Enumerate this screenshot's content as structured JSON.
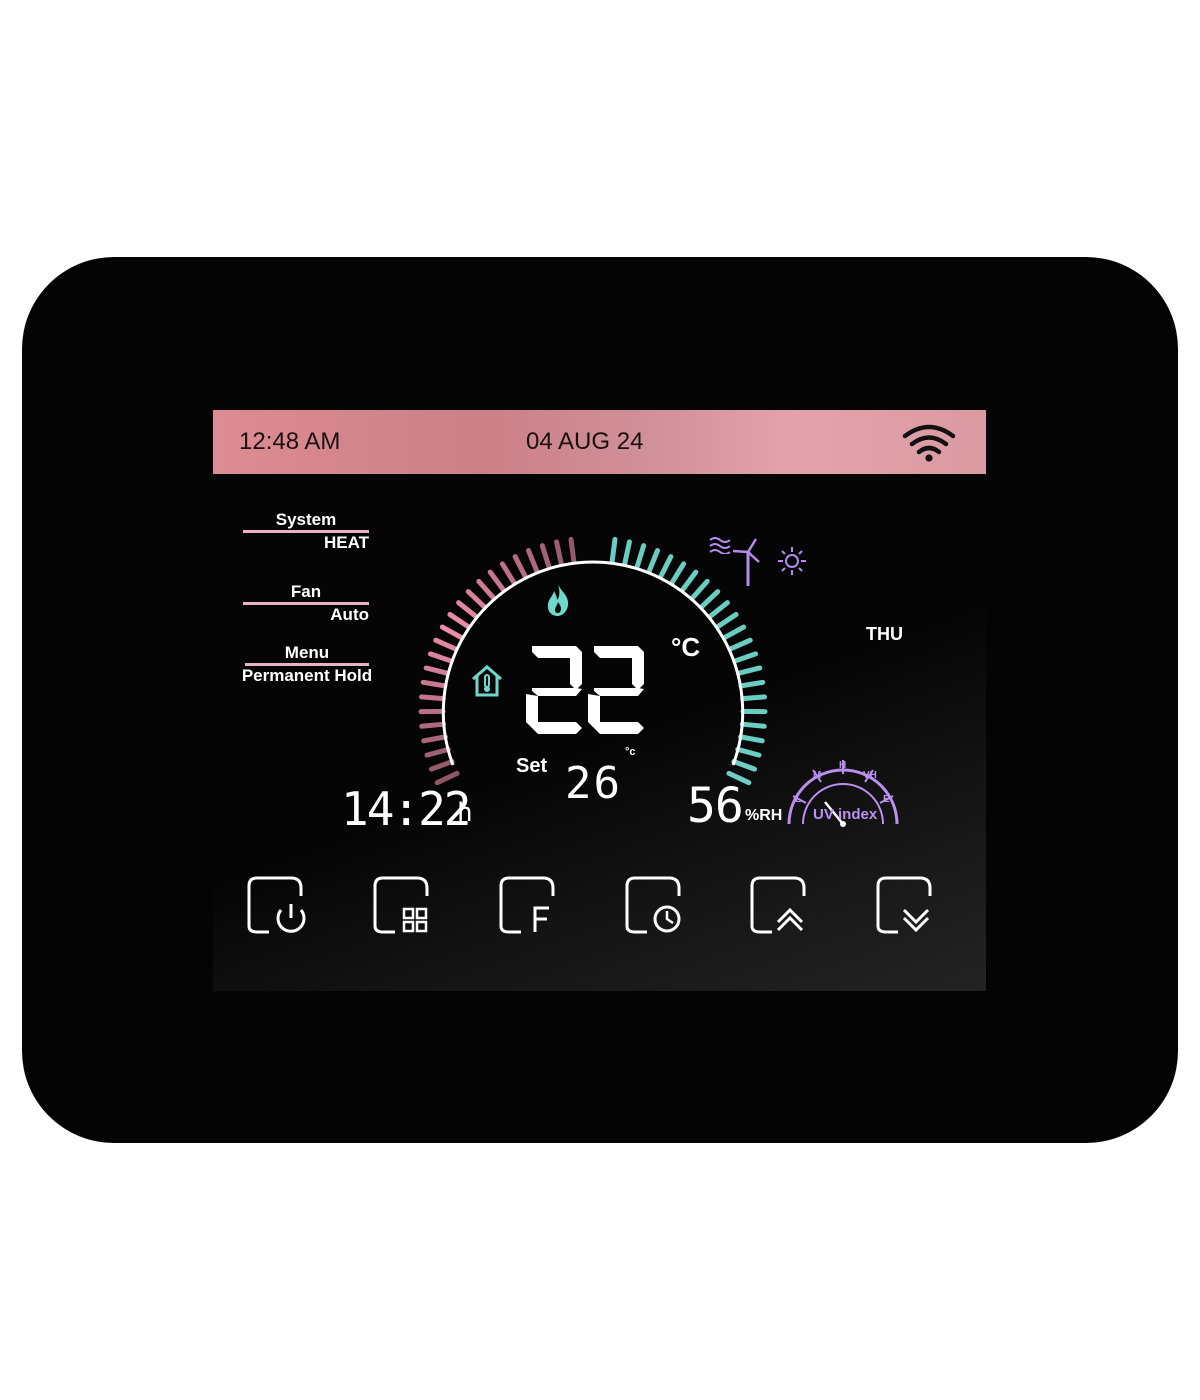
{
  "status_bar": {
    "time": "12:48 AM",
    "date": "04 AUG 24",
    "wifi_icon": "wifi-icon"
  },
  "left_menu": {
    "system": {
      "label": "System",
      "value": "HEAT"
    },
    "fan": {
      "label": "Fan",
      "value": "Auto"
    },
    "menu": {
      "label": "Menu",
      "value": "Permanent Hold"
    }
  },
  "center": {
    "mode_icon": "flame-icon",
    "indoor_icon": "house-thermometer-icon",
    "temperature": "22",
    "temp_unit": "°C",
    "set_label": "Set",
    "set_value": "26",
    "set_unit": "°c"
  },
  "clock": {
    "value": "14:22",
    "suffix": "h"
  },
  "humidity": {
    "value": "56",
    "unit": "%RH"
  },
  "weather": {
    "icons": [
      "wind-icon",
      "wind-turbine-icon",
      "sun-icon"
    ],
    "day": "THU"
  },
  "uv": {
    "label": "UV index",
    "scale": [
      "L",
      "M",
      "H",
      "VH",
      "E"
    ]
  },
  "colors": {
    "accent_pink": "#f08fae",
    "accent_teal": "#6fd8cc",
    "uv_purple": "#b68af0",
    "topbar": "#d48a92"
  },
  "buttons": [
    "power-icon",
    "grid-icon",
    "f-letter-icon",
    "clock-icon",
    "chevron-up-icon",
    "chevron-down-icon"
  ]
}
